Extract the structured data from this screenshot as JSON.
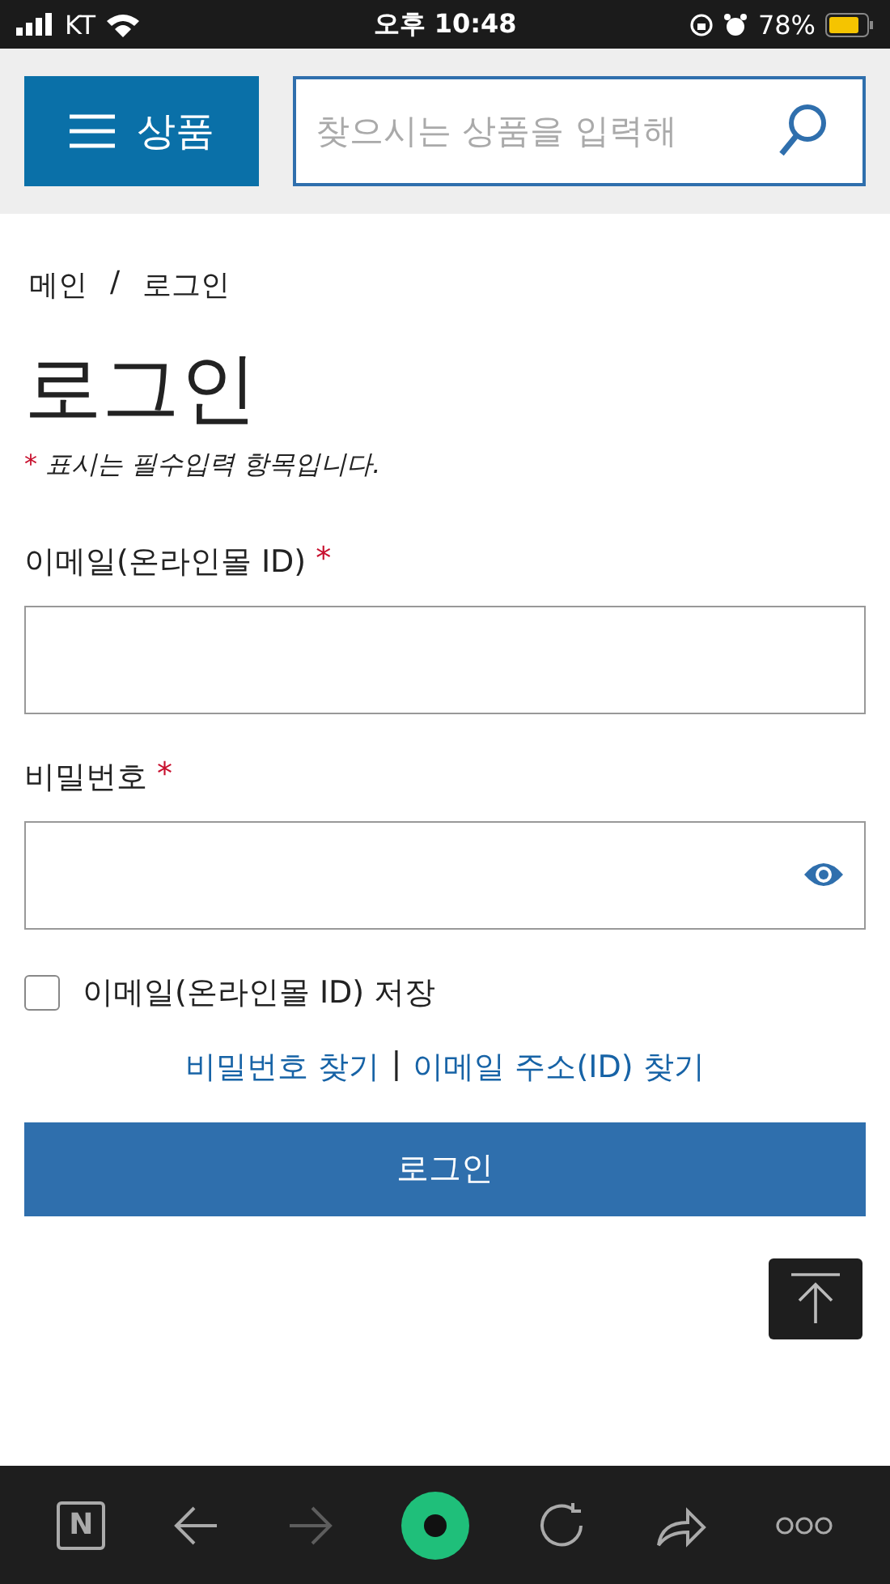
{
  "status_bar": {
    "carrier": "KT",
    "time": "오후 10:48",
    "battery": "78%"
  },
  "header": {
    "menu_label": "상품",
    "search": {
      "placeholder": "찾으시는 상품을 입력해"
    }
  },
  "breadcrumb": [
    "메인",
    "/",
    "로그인"
  ],
  "title": "로그인",
  "required_note": {
    "mark": "*",
    "text": "표시는 필수입력 항목입니다."
  },
  "fields": [
    {
      "label": "이메일(온라인몰 ID)",
      "required_mark": "*",
      "kind": "text"
    },
    {
      "label": "비밀번호",
      "required_mark": "*",
      "kind": "password"
    }
  ],
  "remember": {
    "label": "이메일(온라인몰 ID) 저장",
    "checked": false
  },
  "links": [
    "비밀번호 찾기",
    "|",
    "이메일 주소(ID) 찾기"
  ],
  "login_button": "로그인",
  "browser_toolbar": [
    {
      "kind": "home",
      "glyph": "N",
      "disabled": false
    },
    {
      "kind": "back",
      "disabled": false
    },
    {
      "kind": "forward",
      "disabled": true
    },
    {
      "kind": "tab",
      "disabled": false
    },
    {
      "kind": "reload",
      "disabled": false
    },
    {
      "kind": "share",
      "disabled": false
    },
    {
      "kind": "more",
      "disabled": false
    }
  ]
}
